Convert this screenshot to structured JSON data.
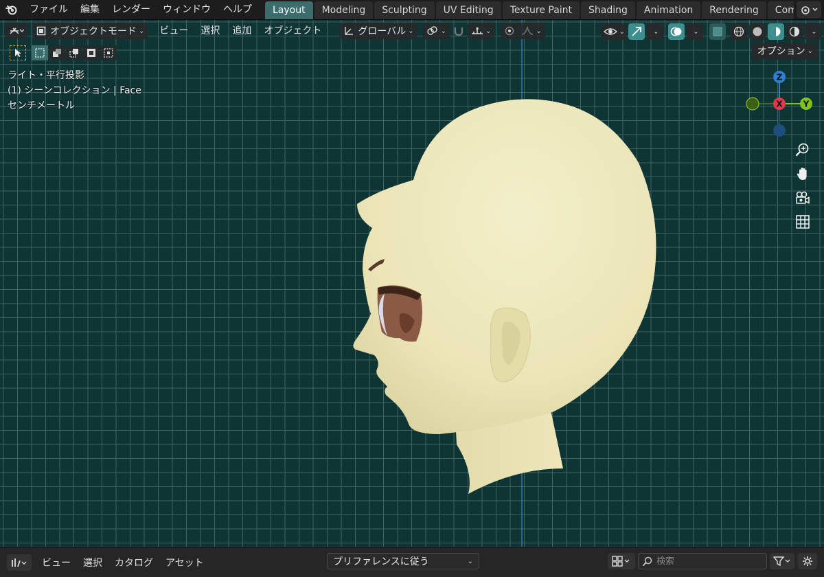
{
  "menu": {
    "items": [
      "ファイル",
      "編集",
      "レンダー",
      "ウィンドウ",
      "ヘルプ"
    ]
  },
  "workspaces": {
    "tabs": [
      "Layout",
      "Modeling",
      "Sculpting",
      "UV Editing",
      "Texture Paint",
      "Shading",
      "Animation",
      "Rendering",
      "Compositi"
    ],
    "active": "Layout"
  },
  "viewport_header": {
    "mode": "オブジェクトモード",
    "menus": [
      "ビュー",
      "選択",
      "追加",
      "オブジェクト"
    ],
    "transform_orientation": "グローバル",
    "options_label": "オプション"
  },
  "overlay_info": {
    "line1": "ライト・平行投影",
    "line2": "(1) シーンコレクション | Face",
    "line3": "センチメートル"
  },
  "gizmo": {
    "z_label": "Z",
    "x_label": "X",
    "y_label": "Y",
    "colors": {
      "x": "#e8364a",
      "y": "#7fc41e",
      "z": "#2d7fd6",
      "neg_y": "#4b6a1a",
      "neg_z": "#1d4e7e"
    }
  },
  "asset_browser": {
    "menus": [
      "ビュー",
      "選択",
      "カタログ",
      "アセット"
    ],
    "library": "プリファレンスに従う",
    "search_placeholder": "検索"
  },
  "theme": {
    "accent": "#3b6d6d",
    "viewport_bg": "#0f3434",
    "model_color": "#ede8bd"
  }
}
